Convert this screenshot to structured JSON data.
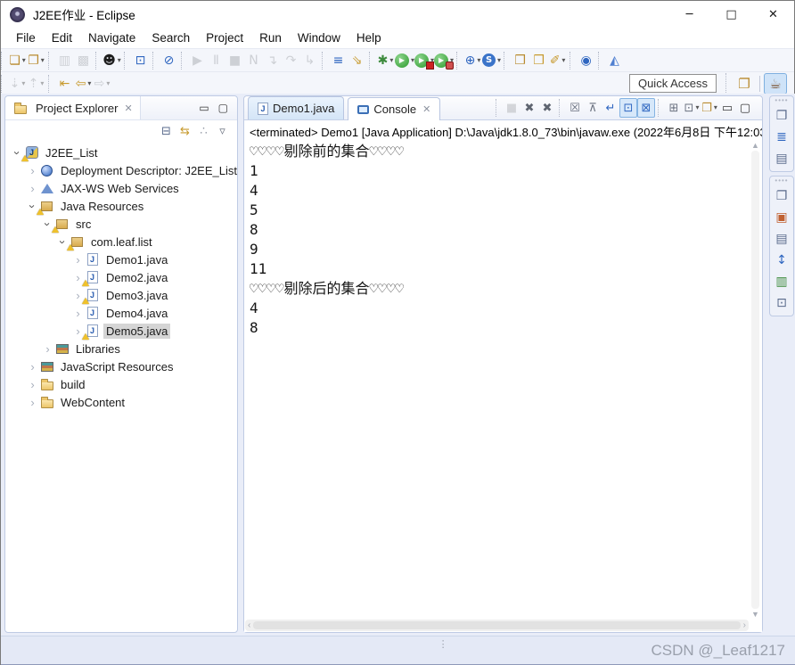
{
  "window": {
    "title": "J2EE作业 - Eclipse",
    "controls": {
      "minimize": "─",
      "maximize": "□",
      "close": "✕"
    }
  },
  "menu": [
    "File",
    "Edit",
    "Navigate",
    "Search",
    "Project",
    "Run",
    "Window",
    "Help"
  ],
  "toolbar_row1": [
    {
      "icons": [
        {
          "n": "new-wizard-icon",
          "g": "❏",
          "c": "#b98b2f",
          "dd": true
        },
        {
          "n": "new-javaee-project-icon",
          "g": "❐",
          "c": "#b98b2f",
          "dd": true
        }
      ]
    },
    {
      "icons": [
        {
          "n": "save-icon",
          "g": "▥",
          "c": "#9aa3b5",
          "dis": true
        },
        {
          "n": "save-all-icon",
          "g": "▩",
          "c": "#9aa3b5",
          "dis": true
        }
      ]
    },
    {
      "icons": [
        {
          "n": "user-account-icon",
          "g": "☻",
          "c": "#1d1d1d",
          "dd": true
        }
      ]
    },
    {
      "icons": [
        {
          "n": "open-terminal-icon",
          "g": "⊡",
          "c": "#2f66c0"
        }
      ]
    },
    {
      "icons": [
        {
          "n": "skip-breakpoints-icon",
          "g": "⊘",
          "c": "#2f66c0"
        }
      ]
    },
    {
      "icons": [
        {
          "n": "resume-icon",
          "g": "▶",
          "c": "#9aa3b5",
          "dis": true
        },
        {
          "n": "suspend-icon",
          "g": "Ⅱ",
          "c": "#9aa3b5",
          "dis": true
        },
        {
          "n": "terminate-icon",
          "g": "■",
          "c": "#9aa3b5",
          "dis": true
        },
        {
          "n": "disconnect-icon",
          "g": "N",
          "c": "#9aa3b5",
          "dis": true
        },
        {
          "n": "step-into-icon",
          "g": "↴",
          "c": "#9aa3b5",
          "dis": true
        },
        {
          "n": "step-over-icon",
          "g": "↷",
          "c": "#9aa3b5",
          "dis": true
        },
        {
          "n": "step-return-icon",
          "g": "↳",
          "c": "#9aa3b5",
          "dis": true
        }
      ]
    },
    {
      "icons": [
        {
          "n": "run-config-icon",
          "g": "≡",
          "c": "#2f66c0"
        },
        {
          "n": "external-tools-icon",
          "g": "⇘",
          "c": "#c79a2e"
        }
      ]
    },
    {
      "icons": [
        {
          "n": "debug-icon",
          "g": "✱",
          "c": "#3c8a3c",
          "dd": true
        },
        {
          "n": "run-icon",
          "style": "runc",
          "g": "▶",
          "dd": true
        },
        {
          "n": "coverage-icon",
          "style": "runc cov",
          "g": "▶",
          "dd": true
        },
        {
          "n": "profile-icon",
          "style": "runc prof",
          "g": "▶",
          "dd": true
        }
      ]
    },
    {
      "icons": [
        {
          "n": "new-web-service-icon",
          "g": "⊕",
          "c": "#2f66c0",
          "dd": true
        },
        {
          "n": "ws-explorer-icon",
          "style": "scircle",
          "g": "S",
          "dd": true
        }
      ]
    },
    {
      "icons": [
        {
          "n": "import-ear-icon",
          "g": "❒",
          "c": "#b98b2f"
        },
        {
          "n": "open-folder-icon",
          "g": "❒",
          "c": "#c79a2e"
        },
        {
          "n": "highlighter-icon",
          "g": "✐",
          "c": "#c79a2e",
          "dd": true
        }
      ]
    },
    {
      "icons": [
        {
          "n": "web-browser-icon",
          "g": "◉",
          "c": "#2f66c0"
        }
      ]
    },
    {
      "icons": [
        {
          "n": "jaxws-wizard-icon",
          "g": "◭",
          "c": "#4f7fd0"
        }
      ]
    }
  ],
  "toolbar_row2": [
    {
      "icons": [
        {
          "n": "next-annotation-icon",
          "g": "⇣",
          "c": "#9aa3b5",
          "dis": true,
          "dd": true
        },
        {
          "n": "prev-annotation-icon",
          "g": "⇡",
          "c": "#9aa3b5",
          "dis": true,
          "dd": true
        }
      ]
    },
    {
      "icons": [
        {
          "n": "last-edit-location-icon",
          "g": "⇤",
          "c": "#c79a2e"
        },
        {
          "n": "back-icon",
          "g": "⇦",
          "c": "#c79a2e",
          "dd": true
        },
        {
          "n": "forward-icon",
          "g": "⇨",
          "c": "#9aa3b5",
          "dis": true,
          "dd": true
        }
      ]
    }
  ],
  "quick_access": {
    "label": "Quick Access"
  },
  "perspectives": [
    {
      "n": "open-perspective-icon",
      "g": "❐",
      "c": "#b98b2f"
    },
    {
      "n": "javaee-perspective-icon",
      "g": "☕",
      "c": "#7a5230",
      "active": true
    }
  ],
  "project_explorer": {
    "title": "Project Explorer",
    "toolbar": [
      {
        "n": "collapse-all-icon",
        "g": "⊟",
        "c": "#5a6b8c"
      },
      {
        "n": "link-with-editor-icon",
        "g": "⇆",
        "c": "#c79a2e"
      },
      {
        "n": "pe-view-menu-icon",
        "g": "∴",
        "c": "#9aa0ab"
      },
      {
        "n": "pe-dropdown-icon",
        "g": "▿",
        "c": "#6b7280"
      }
    ],
    "tree": [
      {
        "label": "J2EE_List",
        "level": 0,
        "exp": "open",
        "icon": "ee-project",
        "warn": true
      },
      {
        "label": "Deployment Descriptor: J2EE_List",
        "level": 1,
        "exp": "closed",
        "icon": "deployment-descriptor"
      },
      {
        "label": "JAX-WS Web Services",
        "level": 1,
        "exp": "closed",
        "icon": "jaxws"
      },
      {
        "label": "Java Resources",
        "level": 1,
        "exp": "open",
        "icon": "java-resources",
        "warn": true
      },
      {
        "label": "src",
        "level": 2,
        "exp": "open",
        "icon": "source-folder",
        "warn": true
      },
      {
        "label": "com.leaf.list",
        "level": 3,
        "exp": "open",
        "icon": "package",
        "warn": true
      },
      {
        "label": "Demo1.java",
        "level": 4,
        "exp": "closed",
        "icon": "java-file"
      },
      {
        "label": "Demo2.java",
        "level": 4,
        "exp": "closed",
        "icon": "java-file",
        "warn": true
      },
      {
        "label": "Demo3.java",
        "level": 4,
        "exp": "closed",
        "icon": "java-file",
        "warn": true
      },
      {
        "label": "Demo4.java",
        "level": 4,
        "exp": "closed",
        "icon": "java-file"
      },
      {
        "label": "Demo5.java",
        "level": 4,
        "exp": "closed",
        "icon": "java-file",
        "warn": true,
        "selected": true
      },
      {
        "label": "Libraries",
        "level": 2,
        "exp": "closed",
        "icon": "libraries"
      },
      {
        "label": "JavaScript Resources",
        "level": 1,
        "exp": "closed",
        "icon": "libraries"
      },
      {
        "label": "build",
        "level": 1,
        "exp": "closed",
        "icon": "folder"
      },
      {
        "label": "WebContent",
        "level": 1,
        "exp": "closed",
        "icon": "folder"
      }
    ]
  },
  "editor": {
    "tabs": [
      {
        "label": "Demo1.java"
      },
      {
        "label": "Console"
      }
    ]
  },
  "console": {
    "toolbar": [
      {
        "icons": [
          {
            "n": "console-terminate-icon",
            "g": "■",
            "c": "#a7adbb",
            "dis": true
          },
          {
            "n": "remove-launch-icon",
            "g": "✖",
            "c": "#5f6570"
          },
          {
            "n": "remove-all-launches-icon",
            "g": "✖",
            "c": "#5f6570"
          }
        ]
      },
      {
        "icons": [
          {
            "n": "clear-console-icon",
            "g": "☒",
            "c": "#6b7280"
          },
          {
            "n": "scroll-lock-icon",
            "g": "⊼",
            "c": "#6b7280"
          },
          {
            "n": "word-wrap-icon",
            "g": "↵",
            "c": "#2f66c0"
          },
          {
            "n": "stdout-toggle-icon",
            "g": "⊡",
            "c": "#2f66c0",
            "on": true
          },
          {
            "n": "stderr-toggle-icon",
            "g": "⊠",
            "c": "#2f66c0",
            "on": true
          }
        ]
      },
      {
        "icons": [
          {
            "n": "pin-console-icon",
            "g": "⊞",
            "c": "#6b7280"
          },
          {
            "n": "display-console-icon",
            "g": "⊡",
            "c": "#6b7280",
            "dd": true
          },
          {
            "n": "open-console-icon",
            "g": "❐",
            "c": "#b98b2f",
            "dd": true
          },
          {
            "n": "console-minimize-icon",
            "g": "▭",
            "c": "#3a3a3a"
          },
          {
            "n": "console-maximize-icon",
            "g": "▢",
            "c": "#3a3a3a"
          }
        ]
      }
    ],
    "status_line": "<terminated> Demo1 [Java Application] D:\\Java\\jdk1.8.0_73\\bin\\javaw.exe (2022年6月8日 下午12:03:",
    "lines": [
      "♡♡♡♡剔除前的集合♡♡♡♡",
      "1",
      "4",
      "5",
      "8",
      "9",
      "11",
      "♡♡♡♡剔除后的集合♡♡♡♡",
      "4",
      "8"
    ]
  },
  "right_strips": [
    {
      "icons": [
        {
          "n": "restore-view-icon",
          "g": "❐",
          "c": "#5a6b8c"
        },
        {
          "n": "outline-view-icon",
          "g": "≣",
          "c": "#2f66c0"
        },
        {
          "n": "task-list-view-icon",
          "g": "▤",
          "c": "#5a6b8c"
        }
      ]
    },
    {
      "icons": [
        {
          "n": "restore-view-icon",
          "g": "❐",
          "c": "#5a6b8c"
        },
        {
          "n": "markers-view-icon",
          "g": "▣",
          "c": "#c06030"
        },
        {
          "n": "properties-view-icon",
          "g": "▤",
          "c": "#5a6b8c"
        },
        {
          "n": "servers-view-icon",
          "g": "↕",
          "c": "#2f66c0"
        },
        {
          "n": "data-source-view-icon",
          "g": "▥",
          "c": "#3c8a3c"
        },
        {
          "n": "snippets-view-icon",
          "g": "⊡",
          "c": "#5a6b8c"
        }
      ]
    }
  ],
  "status_bar": {
    "watermark": "CSDN @_Leaf1217"
  }
}
